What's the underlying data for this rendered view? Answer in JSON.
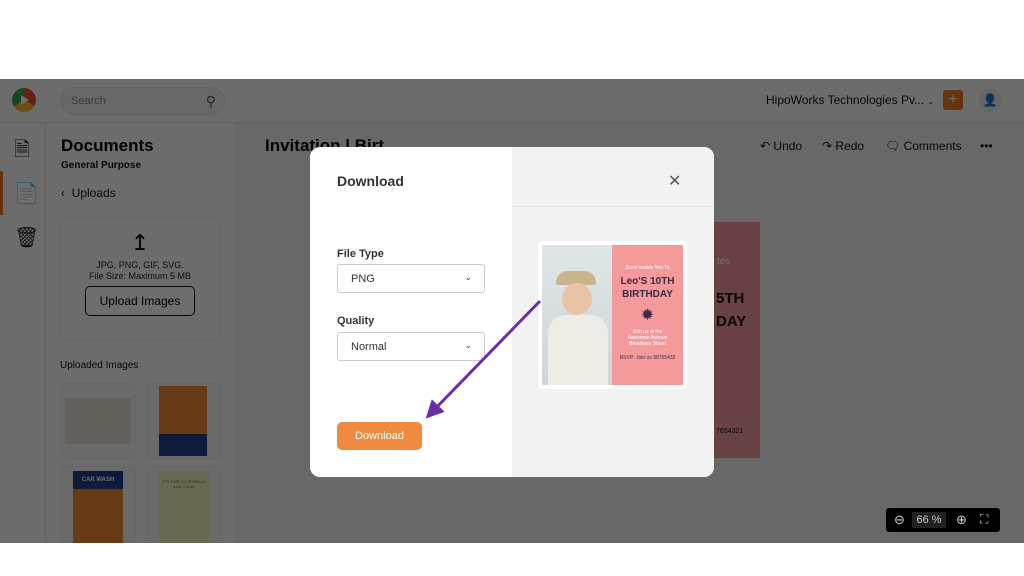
{
  "topbar": {
    "search_placeholder": "Search",
    "org": "HipoWorks Technologies Pv...",
    "plus": "+"
  },
  "panel": {
    "title": "Documents",
    "subtitle": "General Purpose",
    "back": "Uploads",
    "upload_formats": "JPG, PNG, GIF, SVG.",
    "upload_size": "File Size: Maximum 5 MB",
    "upload_button": "Upload Images",
    "uploaded_label": "Uploaded Images",
    "thumbs": [
      "",
      "",
      "CAR WASH",
      "IT'S TIME TO SPARKLE AND SHINE"
    ]
  },
  "canvas": {
    "title": "Invitation | Birt",
    "undo": "Undo",
    "redo": "Redo",
    "comments": "Comments",
    "more": "•••",
    "doc_lines": [
      "tes",
      "5TH",
      "DAY",
      "7654321"
    ],
    "zoom": "66",
    "zoom_unit": "%"
  },
  "modal": {
    "title": "Download",
    "file_type_label": "File Type",
    "file_type_value": "PNG",
    "quality_label": "Quality",
    "quality_value": "Normal",
    "download_button": "Download",
    "preview": {
      "heading": "Leo'S 10TH BIRTHDAY",
      "small_top": "Good invites You To",
      "small_mid": "Join us at the Awesome Avenue Broadway Street",
      "rsvp": "RSVP: Join us 98765432"
    }
  },
  "colors": {
    "accent": "#f08a3e",
    "arrow": "#6a2fa8",
    "preview_pink": "#f59a9b"
  }
}
